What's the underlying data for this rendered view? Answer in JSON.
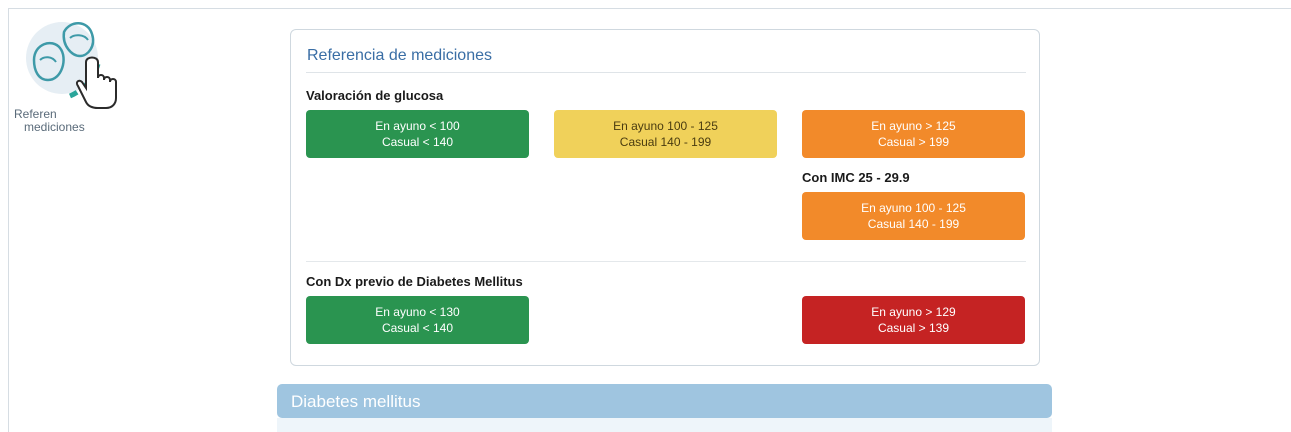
{
  "launcher": {
    "label_line1": "Referen",
    "label_line2": "mediciones",
    "icon": "patients-with-cursor-icon"
  },
  "panel": {
    "title": "Referencia de mediciones",
    "glucose": {
      "label": "Valoración de glucosa",
      "boxes": [
        {
          "line1": "En ayuno < 100",
          "line2": "Casual < 140",
          "status": "normal",
          "color": "#2a9450"
        },
        {
          "line1": "En ayuno 100 - 125",
          "line2": "Casual 140 - 199",
          "status": "warning",
          "color": "#f0d15a"
        },
        {
          "line1": "En ayuno > 125",
          "line2": "Casual > 199",
          "status": "high",
          "color": "#f28a2a"
        }
      ]
    },
    "imc": {
      "label": "Con IMC 25 - 29.9",
      "box": {
        "line1": "En ayuno 100 - 125",
        "line2": "Casual 140 - 199",
        "color": "#f28a2a"
      }
    },
    "diabetes": {
      "label": "Con Dx previo de Diabetes Mellitus",
      "boxes": [
        {
          "line1": "En ayuno < 130",
          "line2": "Casual < 140",
          "color": "#2a9450"
        },
        {
          "line1": "En ayuno > 129",
          "line2": "Casual > 139",
          "color": "#c52323"
        }
      ]
    }
  },
  "section": {
    "title": "Diabetes mellitus",
    "color": "#9fc5e0"
  }
}
